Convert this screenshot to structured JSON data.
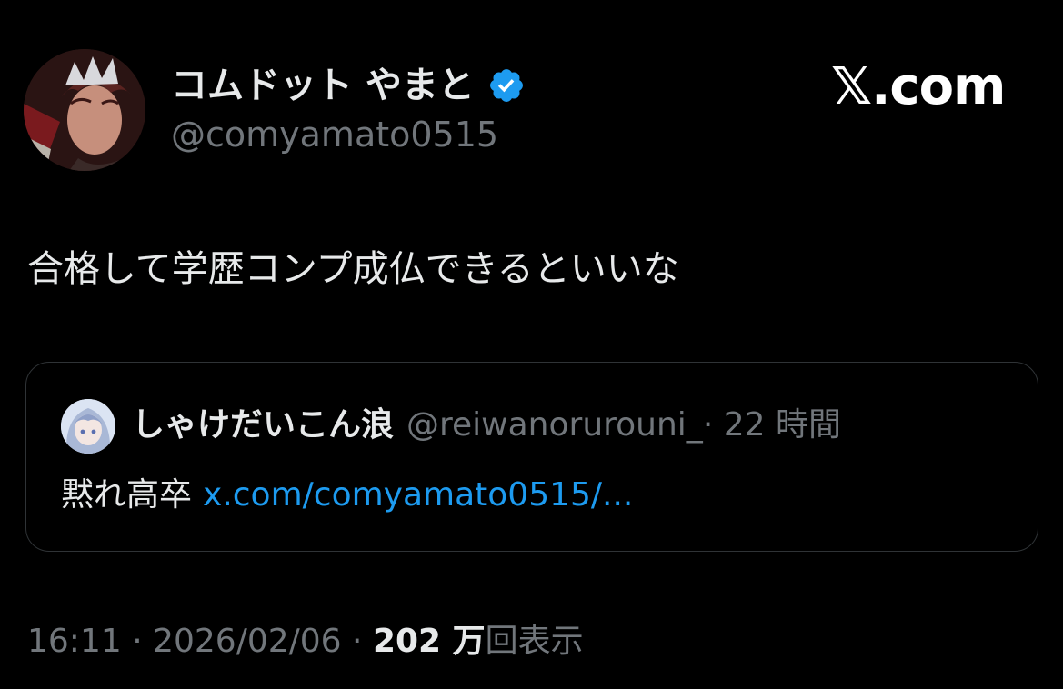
{
  "author": {
    "display_name": "コムドット やまと",
    "handle": "@comyamato0515",
    "verified_icon": "verified-badge-icon",
    "verified_color": "#1d9bf0"
  },
  "brand": "𝕏.com",
  "tweet": {
    "text": "合格して学歴コンプ成仏できるといいな"
  },
  "quote": {
    "display_name": "しゃけだいこん浪",
    "handle": "@reiwanorurouni_",
    "separator": "·",
    "time": "22 時間",
    "text": "黙れ高卒",
    "link": "x.com/comyamato0515/..."
  },
  "meta": {
    "time": "16:11",
    "sep1": " · ",
    "date": "2026/02/06",
    "sep2": " · ",
    "views_count": "202 万",
    "views_label": "回表示"
  },
  "colors": {
    "background": "#000000",
    "text_primary": "#e7e9ea",
    "text_secondary": "#71767b",
    "link": "#1d9bf0",
    "border": "#2f3336"
  }
}
